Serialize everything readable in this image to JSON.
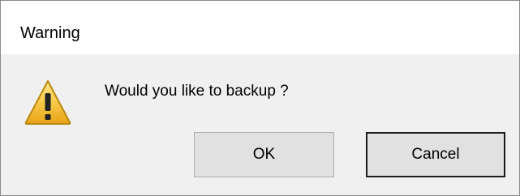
{
  "window": {
    "title": "Warning"
  },
  "message": {
    "text": "Would you like to backup ?"
  },
  "icon": {
    "name": "warning-icon",
    "color": "#f2c230"
  },
  "buttons": {
    "ok_label": "OK",
    "cancel_label": "Cancel"
  }
}
